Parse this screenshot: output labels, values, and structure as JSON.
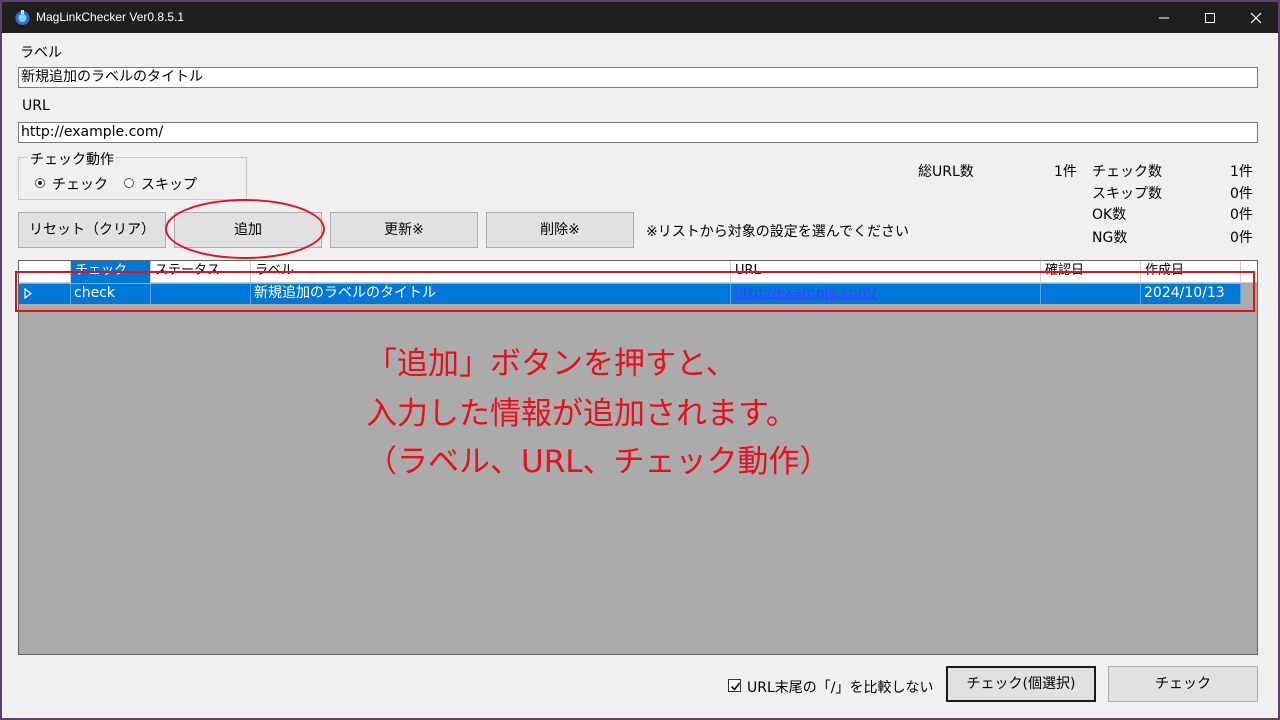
{
  "window": {
    "title": "MagLinkChecker Ver0.8.5.1"
  },
  "form": {
    "label_caption": "ラベル",
    "label_value": "新規追加のラベルのタイトル",
    "url_caption": "URL",
    "url_value": "http://example.com/",
    "check_action": {
      "title": "チェック動作",
      "options": [
        "チェック",
        "スキップ"
      ],
      "selected": "チェック"
    }
  },
  "buttons": {
    "reset": "リセット（クリア）",
    "add": "追加",
    "update": "更新※",
    "delete": "削除※",
    "hint": "※リストから対象の設定を選んでください"
  },
  "stats": {
    "total_label": "総URL数",
    "total_value": "1件",
    "check_label": "チェック数",
    "check_value": "1件",
    "skip_label": "スキップ数",
    "skip_value": "0件",
    "ok_label": "OK数",
    "ok_value": "0件",
    "ng_label": "NG数",
    "ng_value": "0件"
  },
  "grid": {
    "columns": [
      "チェック",
      "ステータス",
      "ラベル",
      "URL",
      "確認日",
      "作成日"
    ],
    "rows": [
      {
        "check": "check",
        "status": "",
        "label": "新規追加のラベルのタイトル",
        "url": "http://example.com/",
        "confirmed": "",
        "created": "2024/10/13"
      }
    ]
  },
  "annotation": {
    "lines": [
      "「追加」ボタンを押すと、",
      "入力した情報が追加されます。",
      "（ラベル、URL、チェック動作）"
    ],
    "color": "#e8101a"
  },
  "footer": {
    "ignore_slash_label": "URL末尾の「/」を比較しない",
    "ignore_slash_checked": true,
    "check_selected_button": "チェック(個選択)",
    "check_button": "チェック"
  },
  "colors": {
    "selection": "#0078d7",
    "titlebar": "#1f1f1f"
  }
}
